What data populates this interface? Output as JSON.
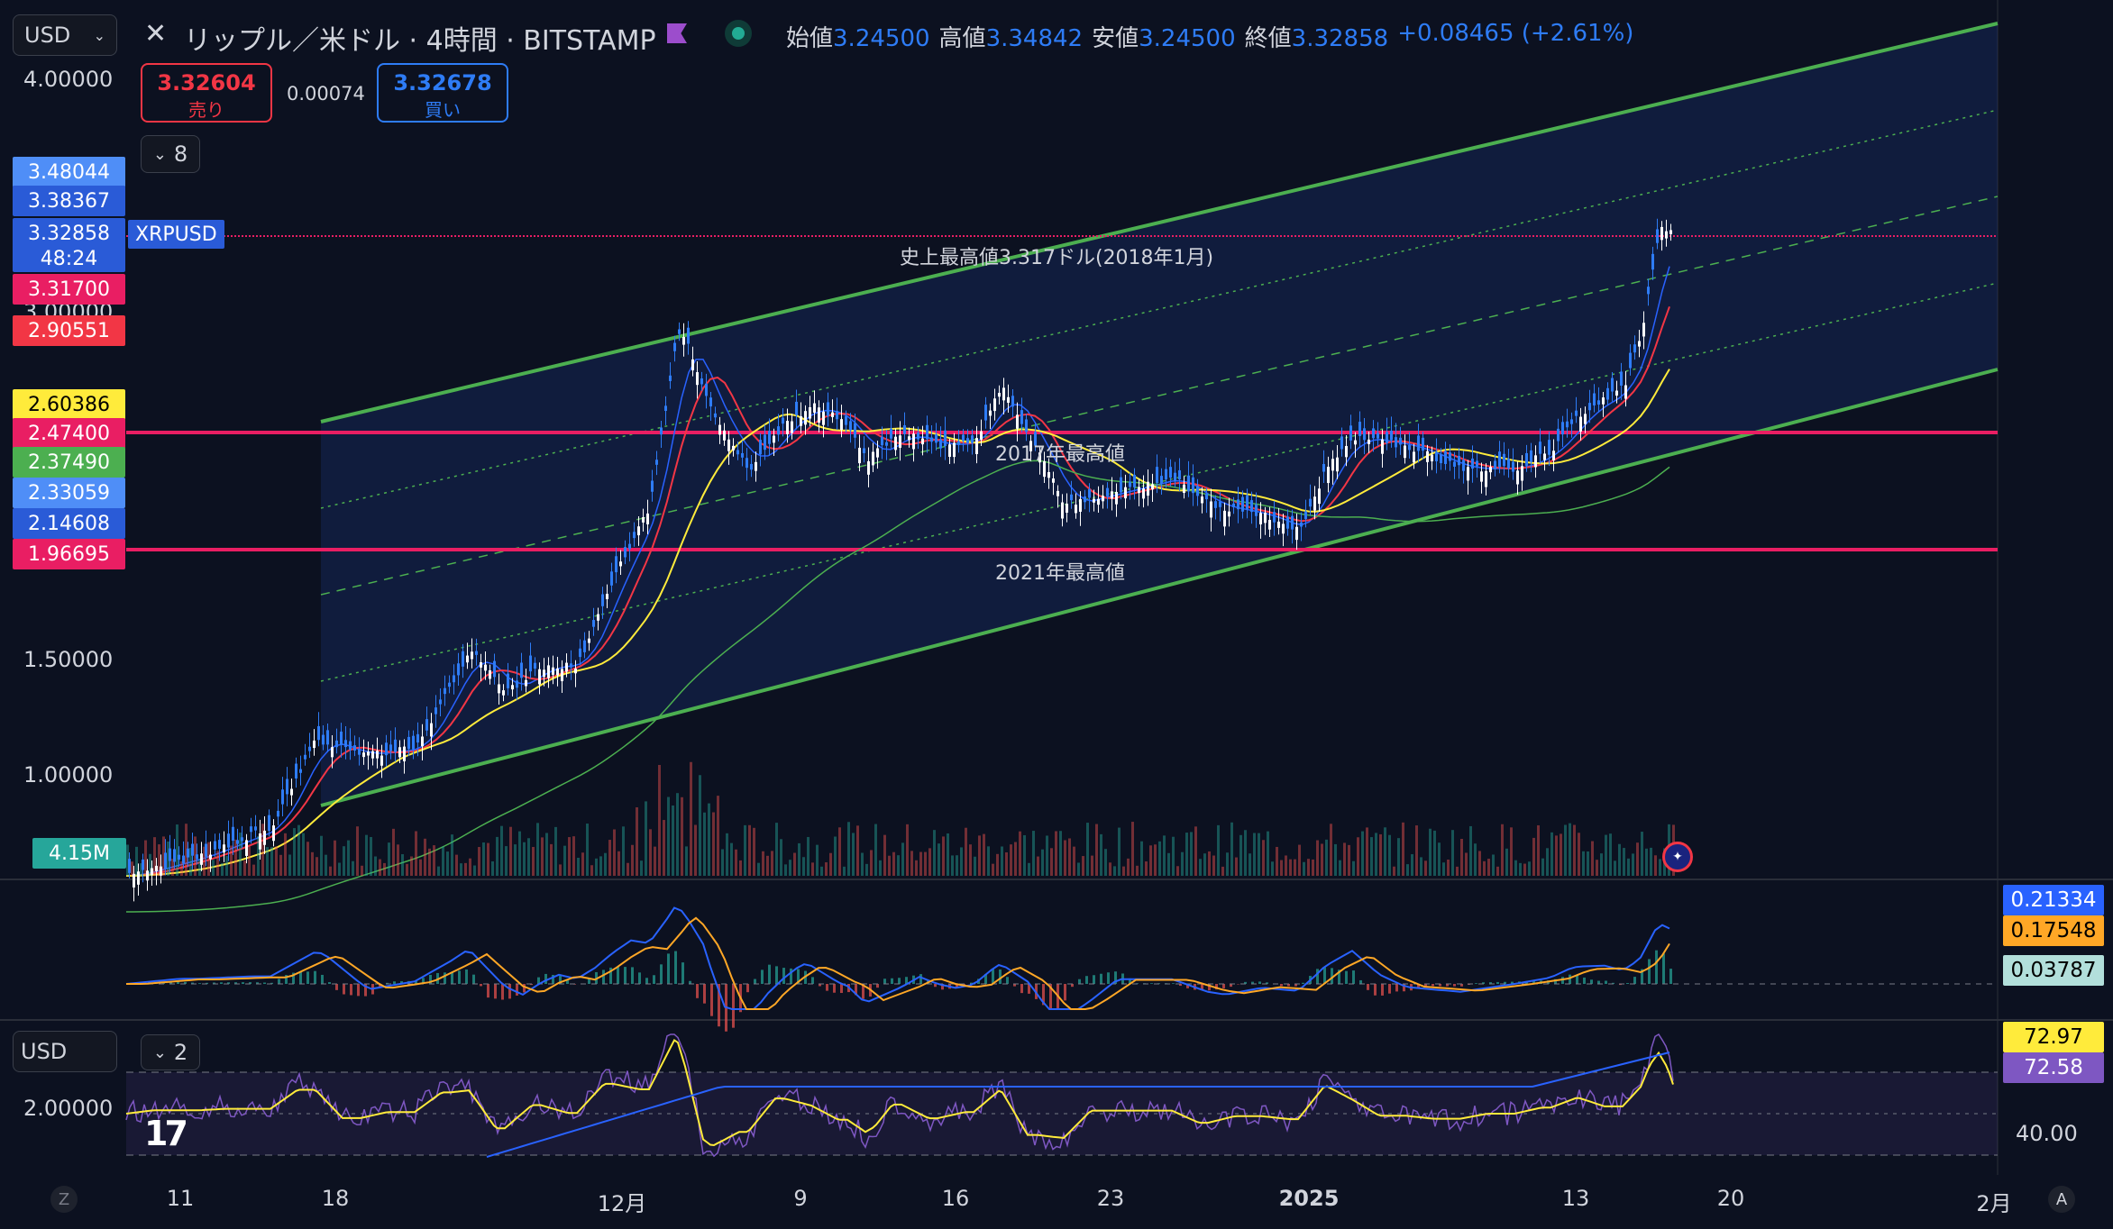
{
  "header": {
    "currency": "USD",
    "symbol_title": "リップル／米ドル · 4時間 · BITSTAMP",
    "ohlc": [
      {
        "k": "始値",
        "v": "3.24500"
      },
      {
        "k": "高値",
        "v": "3.34842"
      },
      {
        "k": "安値",
        "v": "3.24500"
      },
      {
        "k": "終値",
        "v": "3.32858"
      }
    ],
    "change": "+0.08465 (+2.61%)"
  },
  "trade": {
    "sell_price": "3.32604",
    "sell_label": "売り",
    "spread": "0.00074",
    "buy_price": "3.32678",
    "buy_label": "買い"
  },
  "indicator_toggle": {
    "count": "8"
  },
  "rsi_toggle": {
    "count": "2"
  },
  "left_scale": {
    "top": "4.00000",
    "three": "3.00000",
    "one_five": "1.50000",
    "one": "1.00000",
    "rsi_currency": "USD",
    "rsi_value": "2.00000"
  },
  "left_labels": [
    {
      "text": "3.48044",
      "bg": "#4f8ef7"
    },
    {
      "text": "3.38367",
      "bg": "#2a5bd7"
    },
    {
      "text": "3.32858",
      "bg": "#2a5bd7"
    },
    {
      "text": "48:24",
      "bg": "#2a5bd7"
    },
    {
      "text": "3.31700",
      "bg": "#e91e63"
    },
    {
      "text": "2.90551",
      "bg": "#f23645"
    },
    {
      "text": "2.60386",
      "bg": "#ffeb3b"
    },
    {
      "text": "2.47400",
      "bg": "#e91e63"
    },
    {
      "text": "2.37490",
      "bg": "#4caf50"
    },
    {
      "text": "2.33059",
      "bg": "#4f8ef7"
    },
    {
      "text": "2.14608",
      "bg": "#2a5bd7"
    },
    {
      "text": "1.96695",
      "bg": "#e91e63"
    }
  ],
  "symbol_tag": "XRPUSD",
  "volume_label": "4.15M",
  "annotations": {
    "ath": "史上最高値3.317ドル(2018年1月)",
    "high_2017": "2017年最高値",
    "high_2021": "2021年最高値"
  },
  "macd_labels": [
    {
      "text": "0.21334",
      "bg": "#2962ff",
      "fg": "#ffffff"
    },
    {
      "text": "0.17548",
      "bg": "#ffa726",
      "fg": "#000000"
    },
    {
      "text": "0.03787",
      "bg": "#b2dfdb",
      "fg": "#000000"
    }
  ],
  "rsi_labels": [
    {
      "text": "72.97",
      "bg": "#ffeb3b",
      "fg": "#000000"
    },
    {
      "text": "72.58",
      "bg": "#7e57c2",
      "fg": "#ffffff"
    }
  ],
  "rsi_axis": "40.00",
  "time_axis": [
    "11",
    "18",
    "12月",
    "9",
    "16",
    "23",
    "2025",
    "13",
    "20",
    "2月"
  ],
  "corner": {
    "left": "Z",
    "right": "A"
  },
  "colors": {
    "background": "#0c1120",
    "up_candle": "#2e7cf6",
    "down_candle": "#ffffff",
    "channel": "#4caf50",
    "horizontal": "#e91e63",
    "sma_fast": "#f23645",
    "sma_mid": "#ffeb3b",
    "sma_slow": "#4caf50",
    "bollinger": "#2962ff"
  }
}
